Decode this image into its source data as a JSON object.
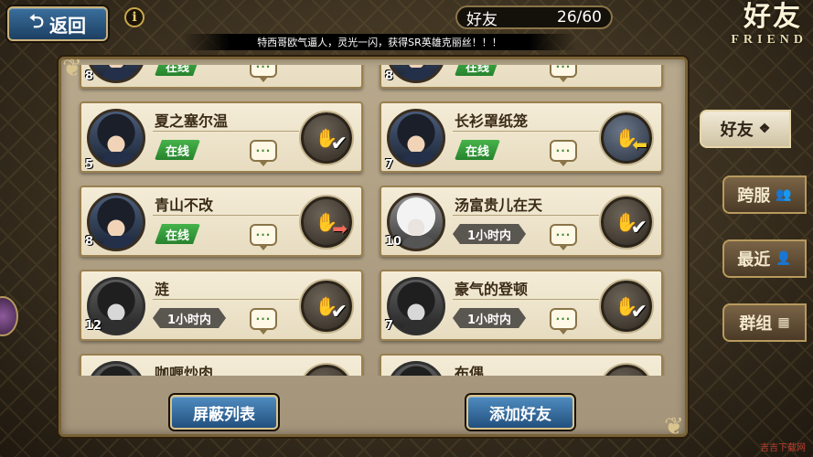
{
  "header": {
    "back_label": "返回",
    "info_label": "i",
    "count_label": "好友",
    "count_value": "26/60",
    "title_cn": "好友",
    "title_en": "FRIEND"
  },
  "ticker": "特西哥欧气逼人，灵光一闪，获得SR英雄克丽丝！！！",
  "friends": [
    {
      "name": "",
      "level": "8",
      "status": "在线",
      "online": true
    },
    {
      "name": "",
      "level": "8",
      "status": "在线",
      "online": true
    },
    {
      "name": "夏之塞尔温",
      "level": "5",
      "status": "在线",
      "online": true,
      "action": "check"
    },
    {
      "name": "长衫罩纸笼",
      "level": "7",
      "status": "在线",
      "online": true,
      "action": "incoming"
    },
    {
      "name": "青山不改",
      "level": "8",
      "status": "在线",
      "online": true,
      "action": "send"
    },
    {
      "name": "汤富贵儿在天",
      "level": "10",
      "status": "1小时内",
      "online": false,
      "action": "check"
    },
    {
      "name": "涟",
      "level": "12",
      "status": "1小时内",
      "online": false,
      "action": "check"
    },
    {
      "name": "豪气的登顿",
      "level": "7",
      "status": "1小时内",
      "online": false,
      "action": "check"
    },
    {
      "name": "咖喱炒肉",
      "level": "",
      "status": "",
      "online": false
    },
    {
      "name": "布偶",
      "level": "",
      "status": "",
      "online": false
    }
  ],
  "tabs": [
    {
      "label": "好友",
      "active": true
    },
    {
      "label": "跨服",
      "active": false
    },
    {
      "label": "最近",
      "active": false
    },
    {
      "label": "群组",
      "active": false
    }
  ],
  "buttons": {
    "block_list": "屏蔽列表",
    "add_friend": "添加好友"
  },
  "chat_glyph": "···",
  "watermark": "吉吉下载网"
}
